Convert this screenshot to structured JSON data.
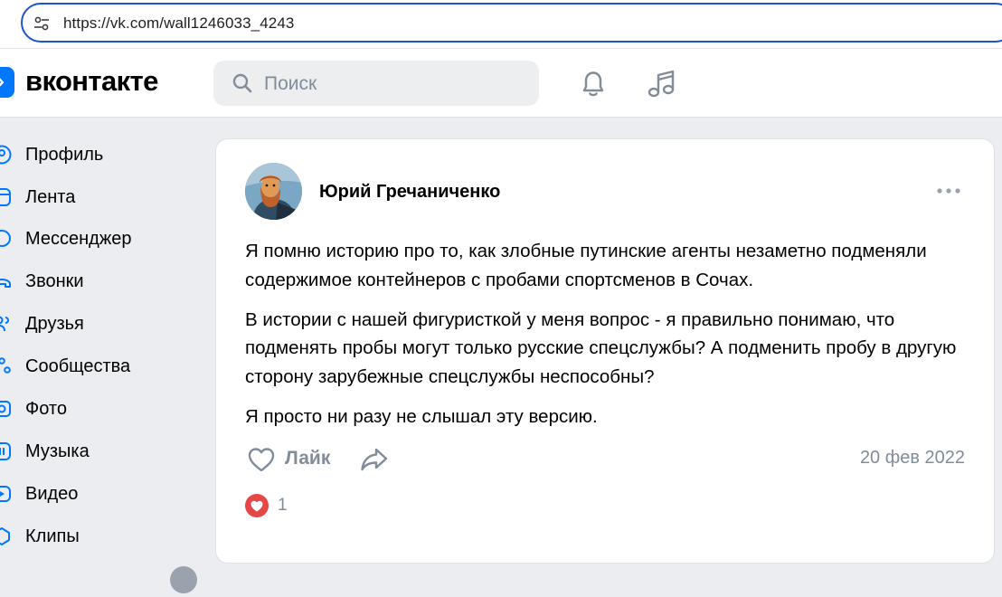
{
  "browser": {
    "url": "https://vk.com/wall1246033_4243"
  },
  "header": {
    "logo_text": "вконтакте",
    "search_placeholder": "Поиск",
    "accent_color": "#0077ff"
  },
  "sidebar": {
    "items": [
      {
        "label": "Профиль",
        "icon": "profile-icon"
      },
      {
        "label": "Лента",
        "icon": "feed-icon"
      },
      {
        "label": "Мессенджер",
        "icon": "messenger-icon"
      },
      {
        "label": "Звонки",
        "icon": "calls-icon"
      },
      {
        "label": "Друзья",
        "icon": "friends-icon"
      },
      {
        "label": "Сообщества",
        "icon": "communities-icon"
      },
      {
        "label": "Фото",
        "icon": "photo-icon"
      },
      {
        "label": "Музыка",
        "icon": "music-icon"
      },
      {
        "label": "Видео",
        "icon": "video-icon"
      },
      {
        "label": "Клипы",
        "icon": "clips-icon"
      }
    ]
  },
  "post": {
    "author": "Юрий Гречаниченко",
    "paragraphs": [
      "Я помню историю про то, как злобные путинские агенты незаметно подменяли содержимое контейнеров с пробами спортсменов в Сочах.",
      "В истории с нашей фигуристкой у меня вопрос - я правильно понимаю, что подменять пробы могут только русские спецслужбы? А подменить пробу в другую сторону зарубежные спецслужбы неспособны?",
      "Я просто ни разу не слышал эту версию."
    ],
    "like_label": "Лайк",
    "date": "20 фев 2022",
    "reaction_count": "1",
    "reaction_color": "#e64646"
  }
}
